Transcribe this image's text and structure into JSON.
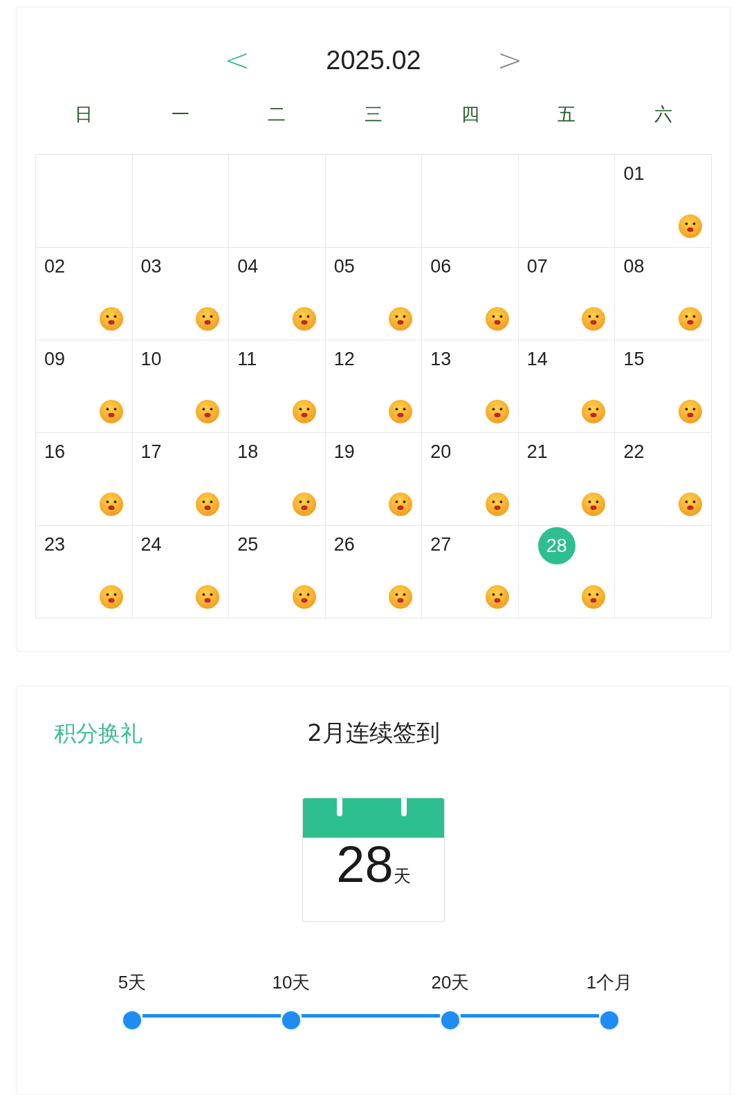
{
  "calendar": {
    "title": "2025.02",
    "prev": "<",
    "next": ">",
    "weekdays": [
      "日",
      "一",
      "二",
      "三",
      "四",
      "五",
      "六"
    ],
    "days": [
      {
        "kind": "empty"
      },
      {
        "kind": "empty"
      },
      {
        "kind": "empty"
      },
      {
        "kind": "empty"
      },
      {
        "kind": "empty"
      },
      {
        "kind": "empty"
      },
      {
        "kind": "day",
        "label": "01",
        "signed": true,
        "selected": false
      },
      {
        "kind": "day",
        "label": "02",
        "signed": true,
        "selected": false
      },
      {
        "kind": "day",
        "label": "03",
        "signed": true,
        "selected": false
      },
      {
        "kind": "day",
        "label": "04",
        "signed": true,
        "selected": false
      },
      {
        "kind": "day",
        "label": "05",
        "signed": true,
        "selected": false
      },
      {
        "kind": "day",
        "label": "06",
        "signed": true,
        "selected": false
      },
      {
        "kind": "day",
        "label": "07",
        "signed": true,
        "selected": false
      },
      {
        "kind": "day",
        "label": "08",
        "signed": true,
        "selected": false
      },
      {
        "kind": "day",
        "label": "09",
        "signed": true,
        "selected": false
      },
      {
        "kind": "day",
        "label": "10",
        "signed": true,
        "selected": false
      },
      {
        "kind": "day",
        "label": "11",
        "signed": true,
        "selected": false
      },
      {
        "kind": "day",
        "label": "12",
        "signed": true,
        "selected": false
      },
      {
        "kind": "day",
        "label": "13",
        "signed": true,
        "selected": false
      },
      {
        "kind": "day",
        "label": "14",
        "signed": true,
        "selected": false
      },
      {
        "kind": "day",
        "label": "15",
        "signed": true,
        "selected": false
      },
      {
        "kind": "day",
        "label": "16",
        "signed": true,
        "selected": false
      },
      {
        "kind": "day",
        "label": "17",
        "signed": true,
        "selected": false
      },
      {
        "kind": "day",
        "label": "18",
        "signed": true,
        "selected": false
      },
      {
        "kind": "day",
        "label": "19",
        "signed": true,
        "selected": false
      },
      {
        "kind": "day",
        "label": "20",
        "signed": true,
        "selected": false
      },
      {
        "kind": "day",
        "label": "21",
        "signed": true,
        "selected": false
      },
      {
        "kind": "day",
        "label": "22",
        "signed": true,
        "selected": false
      },
      {
        "kind": "day",
        "label": "23",
        "signed": true,
        "selected": false
      },
      {
        "kind": "day",
        "label": "24",
        "signed": true,
        "selected": false
      },
      {
        "kind": "day",
        "label": "25",
        "signed": true,
        "selected": false
      },
      {
        "kind": "day",
        "label": "26",
        "signed": true,
        "selected": false
      },
      {
        "kind": "day",
        "label": "27",
        "signed": true,
        "selected": false
      },
      {
        "kind": "day",
        "label": "28",
        "signed": true,
        "selected": true
      },
      {
        "kind": "empty"
      }
    ]
  },
  "streak": {
    "link": "积分换礼",
    "title": "2月连续签到",
    "count": "28",
    "unit": "天",
    "milestones": [
      "5天",
      "10天",
      "20天",
      "1个月"
    ]
  }
}
